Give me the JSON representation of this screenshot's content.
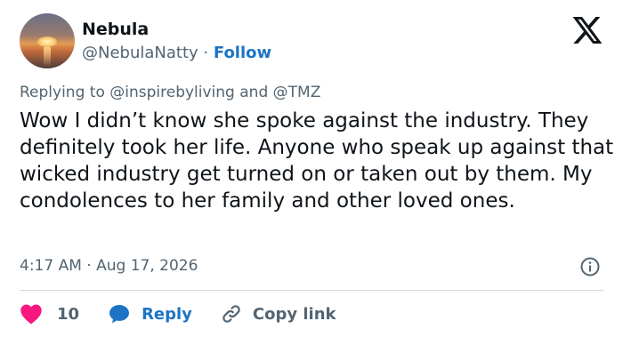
{
  "user": {
    "display_name": "Nebula",
    "handle": "@NebulaNatty",
    "separator": "·",
    "follow_label": "Follow"
  },
  "reply_context": {
    "prefix": "Replying to",
    "mention_1": "@inspirebyliving",
    "conjunction": "and",
    "mention_2": "@TMZ"
  },
  "tweet": {
    "text": "Wow I didn’t know she spoke against the industry. They definitely took her life. Anyone who speak up against that wicked industry get turned on or taken out by them. My condolences to her family and other loved ones.",
    "time": "4:17 AM",
    "separator": "·",
    "date": "Aug 17, 2026"
  },
  "actions": {
    "like_count": "10",
    "reply_label": "Reply",
    "copy_link_label": "Copy link"
  },
  "icons": {
    "logo": "x-logo-icon",
    "info": "info-icon",
    "like": "heart-icon",
    "reply": "speech-bubble-icon",
    "copy": "link-icon"
  },
  "colors": {
    "heart": "#f91880",
    "link_blue": "#1d74c4",
    "muted": "#536471",
    "text": "#0f1419",
    "divider": "#cfd9de"
  }
}
